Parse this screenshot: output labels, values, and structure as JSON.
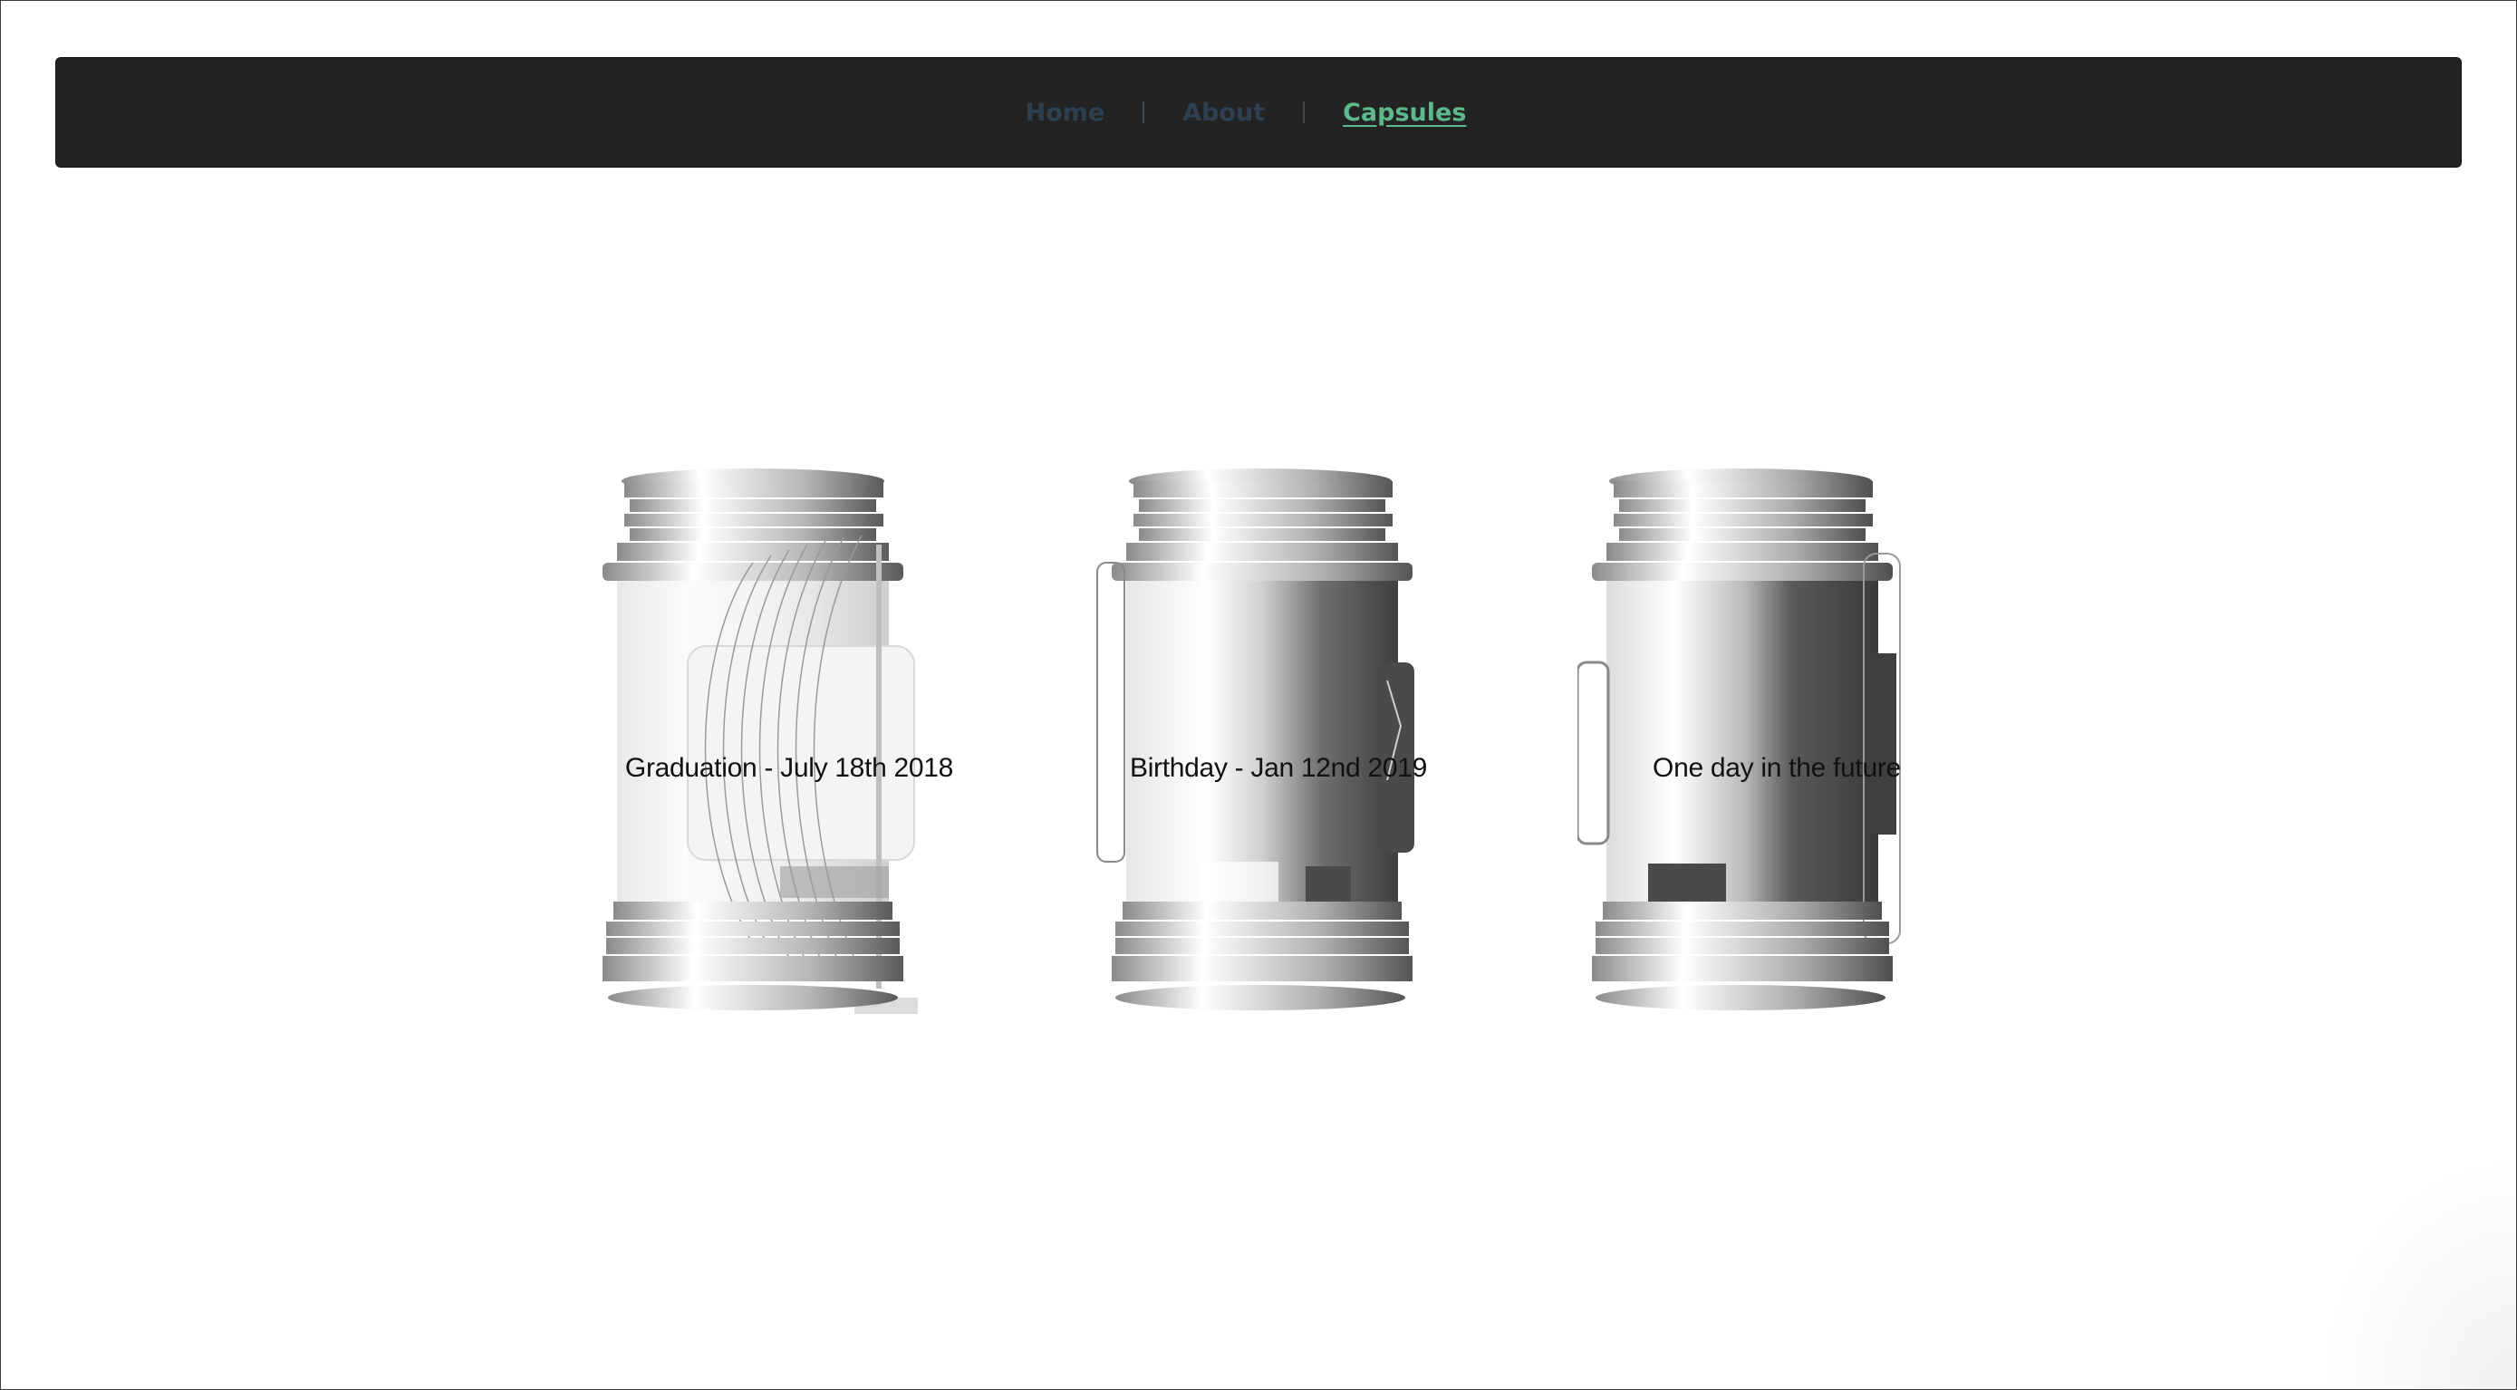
{
  "nav": {
    "items": [
      {
        "label": "Home",
        "active": false
      },
      {
        "label": "About",
        "active": false
      },
      {
        "label": "Capsules",
        "active": true
      }
    ],
    "colors": {
      "background": "#232323",
      "link": "#2e3f52",
      "active": "#5db88c"
    }
  },
  "capsules": [
    {
      "label": "Graduation - July 18th 2018"
    },
    {
      "label": "Birthday - Jan 12nd 2019"
    },
    {
      "label": "One day in the future"
    }
  ]
}
